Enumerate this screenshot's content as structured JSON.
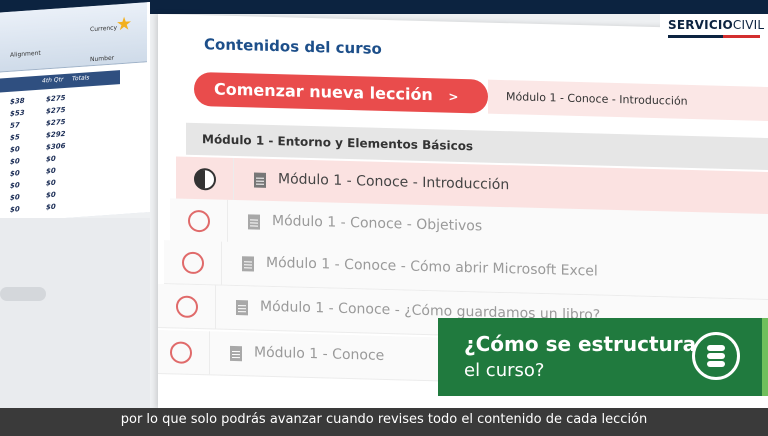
{
  "brand": {
    "logo_bold": "SERVICIO",
    "logo_thin": "CIVIL"
  },
  "spreadsheet": {
    "ribbon_labels": [
      "Currency",
      "Alignment",
      "Number"
    ],
    "column_headers": [
      "4th Qtr",
      "Totals"
    ],
    "rows": [
      [
        "$38",
        "$275"
      ],
      [
        "$53",
        "$275"
      ],
      [
        "57",
        "$275"
      ],
      [
        "$5",
        "$292"
      ],
      [
        "$0",
        "$306"
      ],
      [
        "$0",
        "$0"
      ],
      [
        "$0",
        "$0"
      ],
      [
        "$0",
        "$0"
      ],
      [
        "$0",
        "$0"
      ],
      [
        "$0",
        "$0"
      ]
    ]
  },
  "course": {
    "title": "Contenidos del curso",
    "start_button": "Comenzar nueva lección",
    "start_chevron": ">",
    "current_lesson": "Módulo 1 - Conoce - Introducción",
    "section_title": "Módulo 1 - Entorno y Elementos Básicos",
    "lessons": [
      {
        "label": "Módulo 1 - Conoce - Introducción",
        "status": "in-progress"
      },
      {
        "label": "Módulo 1 - Conoce - Objetivos",
        "status": "pending"
      },
      {
        "label": "Módulo 1 - Conoce - Cómo abrir Microsoft Excel",
        "status": "pending"
      },
      {
        "label": "Módulo 1 - Conoce - ¿Cómo guardamos un libro?",
        "status": "pending"
      },
      {
        "label": "Módulo 1 - Conoce",
        "status": "pending"
      }
    ]
  },
  "overlay": {
    "line1": "¿Cómo se estructura",
    "line2": "el curso?",
    "icon": "database-icon"
  },
  "subtitle": "por lo que solo podrás avanzar cuando revises todo el contenido de cada lección",
  "colors": {
    "accent_red": "#e94c4c",
    "title_blue": "#1d4f8a",
    "overlay_green": "#207a3e"
  }
}
